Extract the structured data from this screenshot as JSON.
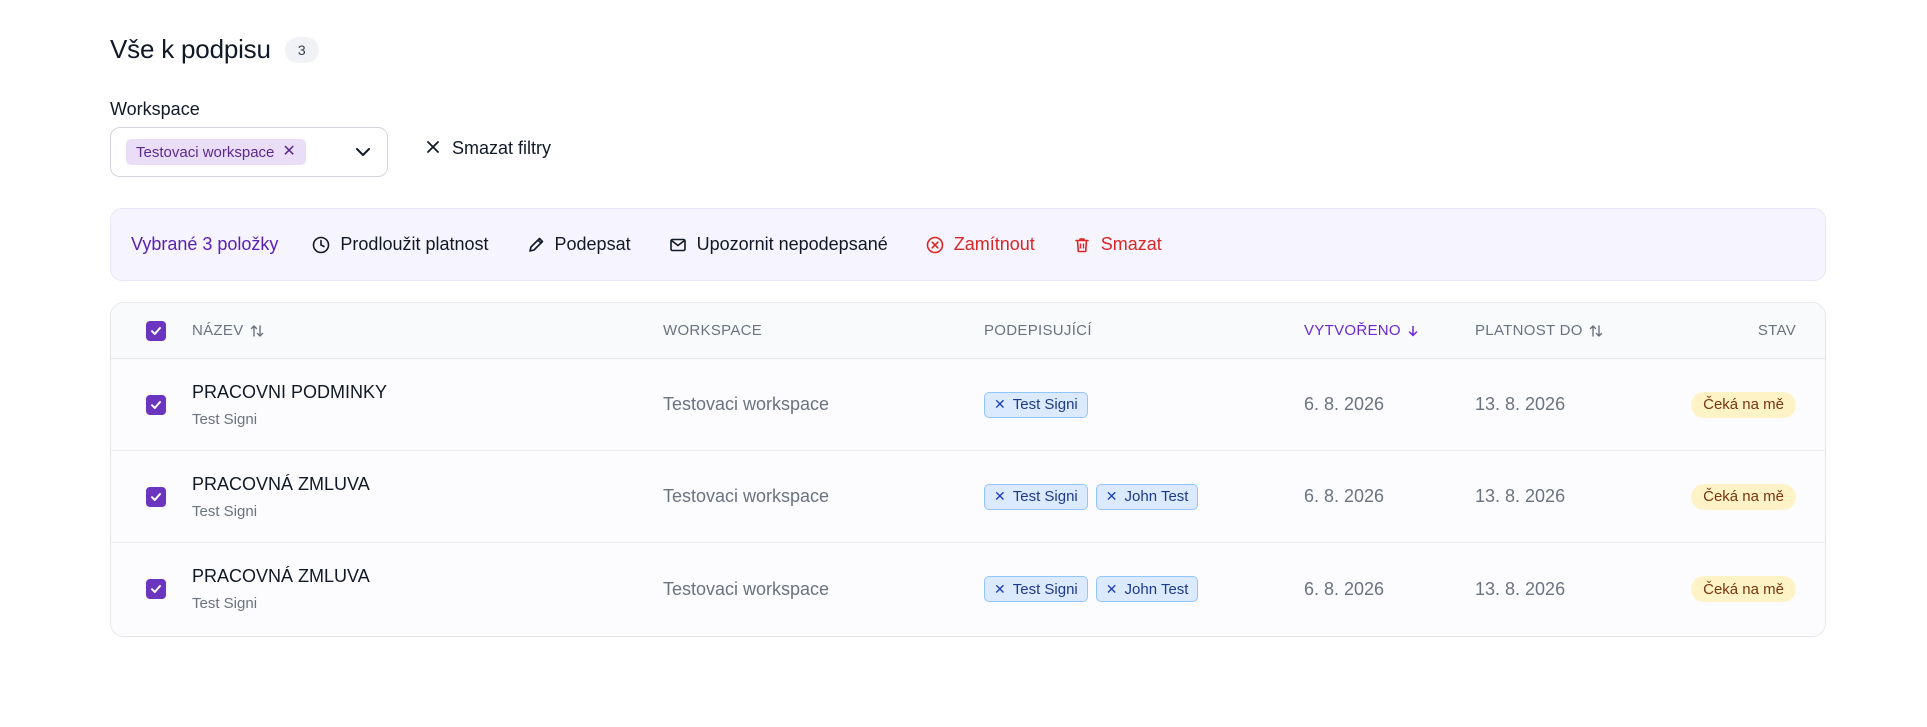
{
  "header": {
    "title": "Vše k podpisu",
    "count": "3"
  },
  "filter": {
    "label": "Workspace",
    "selected_chip": "Testovaci workspace",
    "clear_label": "Smazat filtry"
  },
  "action_bar": {
    "selected_text": "Vybrané 3 položky",
    "extend_label": "Prodloužit platnost",
    "sign_label": "Podepsat",
    "notify_label": "Upozornit nepodepsané",
    "reject_label": "Zamítnout",
    "delete_label": "Smazat"
  },
  "table": {
    "columns": {
      "name": "NÁZEV",
      "workspace": "WORKSPACE",
      "signers": "PODEPISUJÍCÍ",
      "created": "VYTVOŘENO",
      "valid_until": "PLATNOST DO",
      "status": "STAV"
    },
    "rows": [
      {
        "name": "PRACOVNI PODMINKY",
        "owner": "Test Signi",
        "workspace": "Testovaci workspace",
        "signers": [
          "Test Signi"
        ],
        "created": "6. 8. 2026",
        "valid_until": "13. 8. 2026",
        "status": "Čeká na mě"
      },
      {
        "name": "PRACOVNÁ ZMLUVA",
        "owner": "Test Signi",
        "workspace": "Testovaci workspace",
        "signers": [
          "Test Signi",
          "John Test"
        ],
        "created": "6. 8. 2026",
        "valid_until": "13. 8. 2026",
        "status": "Čeká na mě"
      },
      {
        "name": "PRACOVNÁ ZMLUVA",
        "owner": "Test Signi",
        "workspace": "Testovaci workspace",
        "signers": [
          "Test Signi",
          "John Test"
        ],
        "created": "6. 8. 2026",
        "valid_until": "13. 8. 2026",
        "status": "Čeká na mě"
      }
    ]
  },
  "colors": {
    "accent": "#6d28d9",
    "checkbox": "#6b35c0",
    "danger": "#dc2626",
    "chip_purple_bg": "#e9ddf7",
    "chip_blue_bg": "#dbeafe",
    "status_bg": "#fef3c7",
    "action_bar_bg": "#f6f4fe"
  },
  "icons": {
    "clear": "close-icon",
    "extend": "clock-icon",
    "sign": "pencil-icon",
    "notify": "mail-icon",
    "reject": "x-circle-icon",
    "delete": "trash-icon",
    "sort": "sort-icon",
    "sort_desc": "arrow-down-icon",
    "select": "chevron-down-icon",
    "checkbox": "check-icon"
  }
}
